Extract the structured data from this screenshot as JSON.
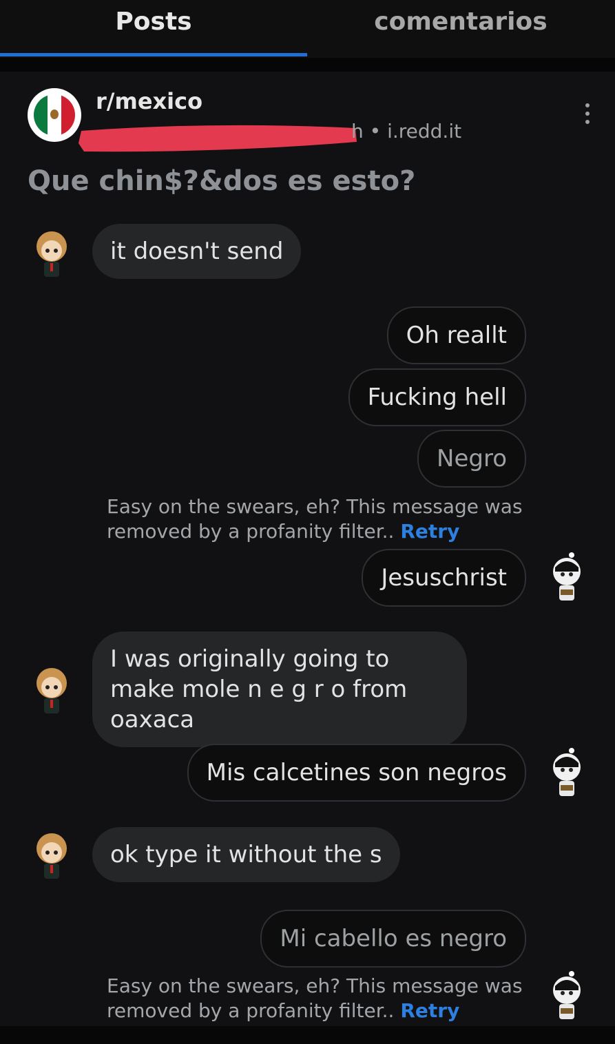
{
  "tabs": [
    {
      "label": "Posts",
      "active": true
    },
    {
      "label": "comentarios",
      "active": false
    }
  ],
  "post": {
    "subreddit": "r/mexico",
    "meta_suffix": "h • i.redd.it",
    "title": "Que chin$?&dos es esto?",
    "redaction_color": "#e33a4f"
  },
  "messages": [
    {
      "side": "in",
      "text": "it doesn't send"
    },
    {
      "side": "out",
      "text": "Oh reallt"
    },
    {
      "side": "out",
      "text": "Fucking hell"
    },
    {
      "side": "out",
      "text": "Negro",
      "removed": true
    },
    {
      "side": "out",
      "text": "Jesuschrist"
    },
    {
      "side": "in",
      "text": "I was originally going to make mole n e g r o from oaxaca"
    },
    {
      "side": "out",
      "text": "Mis calcetines son negros"
    },
    {
      "side": "in",
      "text": "ok type it without the s"
    },
    {
      "side": "out",
      "text": "Mi cabello es negro",
      "removed": true
    }
  ],
  "removed_notice": {
    "text": "Easy on the swears, eh? This message was removed by a profanity filter.. ",
    "retry_label": "Retry"
  },
  "colors": {
    "accent": "#1f6fd6",
    "retry": "#2d7fe0",
    "background": "#111113"
  }
}
